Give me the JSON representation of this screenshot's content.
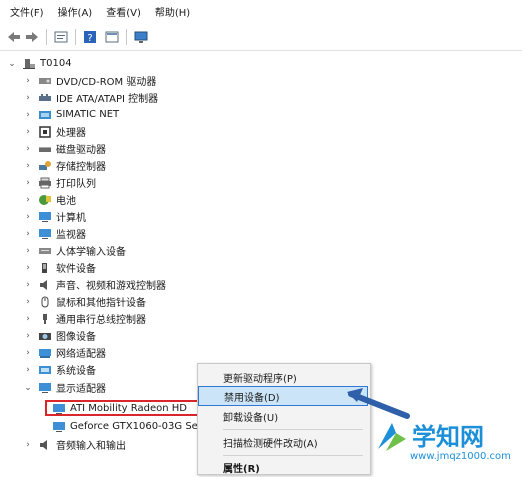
{
  "menu": [
    "文件(F)",
    "操作(A)",
    "查看(V)",
    "帮助(H)"
  ],
  "toolbar_icons": [
    "back-arrow-icon",
    "forward-arrow-icon",
    "properties-icon",
    "help-icon",
    "view-icon",
    "monitor-icon"
  ],
  "root": "T0104",
  "categories": [
    "DVD/CD-ROM 驱动器",
    "IDE ATA/ATAPI 控制器",
    "SIMATIC NET",
    "处理器",
    "磁盘驱动器",
    "存储控制器",
    "打印队列",
    "电池",
    "计算机",
    "监视器",
    "人体学输入设备",
    "软件设备",
    "声音、视频和游戏控制器",
    "鼠标和其他指针设备",
    "通用串行总线控制器",
    "图像设备",
    "网络适配器",
    "系统设备",
    "显示适配器"
  ],
  "display_children": [
    "ATI Mobility Radeon HD",
    "Geforce GTX1060-03G Se"
  ],
  "last_category": "音频输入和输出",
  "context_menu": {
    "update": "更新驱动程序(P)",
    "disable": "禁用设备(D)",
    "uninstall": "卸载设备(U)",
    "scan": "扫描检测硬件改动(A)",
    "properties": "属性(R)"
  },
  "watermark": {
    "title": "学知网",
    "url": "www.jmqz1000.com"
  },
  "colors": {
    "highlight_border": "#d9262b",
    "selection": "#cce4f7",
    "arrow": "#2f5fa8",
    "brand": "#1c8fd9"
  }
}
